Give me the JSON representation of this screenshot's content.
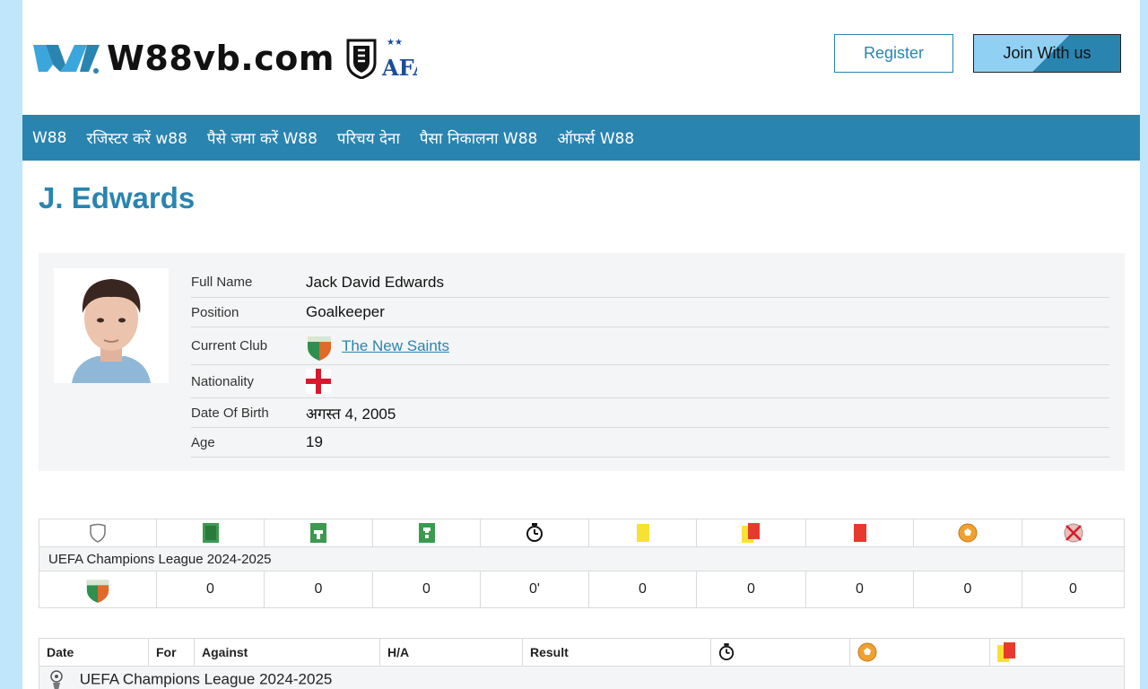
{
  "header": {
    "site_name": "W88vb.com",
    "register_label": "Register",
    "join_label": "Join With us"
  },
  "nav": {
    "items": [
      "W88",
      "रजिस्टर करें w88",
      "पैसे जमा करें W88",
      "परिचय देना",
      "पैसा निकालना W88",
      "ऑफर्स W88"
    ]
  },
  "player": {
    "name": "J. Edwards",
    "fields": [
      {
        "label": "Full Name",
        "value": "Jack David Edwards"
      },
      {
        "label": "Position",
        "value": "Goalkeeper"
      },
      {
        "label": "Current Club",
        "value": "The New Saints"
      },
      {
        "label": "Nationality",
        "value": ""
      },
      {
        "label": "Date Of Birth",
        "value": "अगस्त 4, 2005"
      },
      {
        "label": "Age",
        "value": "19"
      }
    ]
  },
  "stats": {
    "icons": [
      "shield-icon",
      "appearances-icon",
      "lineups-icon",
      "substitute-icon",
      "stopwatch-icon",
      "yellow-card-icon",
      "yellow-red-card-icon",
      "red-card-icon",
      "goal-ball-icon",
      "own-goal-icon"
    ],
    "league": "UEFA Champions League 2024-2025",
    "values": [
      "0",
      "0",
      "0",
      "0'",
      "0",
      "0",
      "0",
      "0",
      "0"
    ]
  },
  "matches": {
    "headers": [
      "Date",
      "For",
      "Against",
      "H/A",
      "Result"
    ],
    "group_label": "UEFA Champions League 2024-2025"
  },
  "colors": {
    "accent": "#2a84b0",
    "background": "#bfe6fb",
    "panel": "#f4f5f6"
  }
}
